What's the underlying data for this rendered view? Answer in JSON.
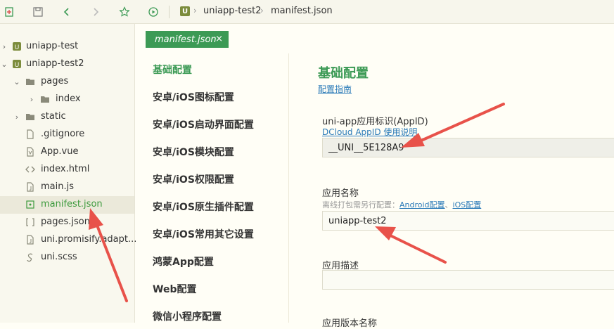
{
  "breadcrumb": {
    "logo": "U",
    "project": "uniapp-test2",
    "file": "manifest.json"
  },
  "tree": [
    {
      "label": "uniapp-test",
      "type": "project",
      "twisty": "collapsed"
    },
    {
      "label": "uniapp-test2",
      "type": "project",
      "twisty": "expanded"
    },
    {
      "label": "pages",
      "type": "folder-open",
      "twisty": "expanded"
    },
    {
      "label": "index",
      "type": "folder",
      "twisty": "collapsed"
    },
    {
      "label": "static",
      "type": "folder",
      "twisty": "collapsed"
    },
    {
      "label": ".gitignore",
      "type": "file"
    },
    {
      "label": "App.vue",
      "type": "vue-file"
    },
    {
      "label": "index.html",
      "type": "html-file"
    },
    {
      "label": "main.js",
      "type": "js-file"
    },
    {
      "label": "manifest.json",
      "type": "json-file",
      "selected": true
    },
    {
      "label": "pages.json",
      "type": "json-file"
    },
    {
      "label": "uni.promisify.adapt...",
      "type": "js-file"
    },
    {
      "label": "uni.scss",
      "type": "scss-file"
    }
  ],
  "tab": {
    "label": "manifest.json",
    "close": "×"
  },
  "nav": [
    {
      "label": "基础配置",
      "active": true
    },
    {
      "label": "安卓/iOS图标配置"
    },
    {
      "label": "安卓/iOS启动界面配置"
    },
    {
      "label": "安卓/iOS模块配置"
    },
    {
      "label": "安卓/iOS权限配置"
    },
    {
      "label": "安卓/iOS原生插件配置"
    },
    {
      "label": "安卓/iOS常用其它设置"
    },
    {
      "label": "鸿蒙App配置"
    },
    {
      "label": "Web配置"
    },
    {
      "label": "微信小程序配置"
    }
  ],
  "content": {
    "title": "基础配置",
    "guide_link": "配置指南",
    "appid": {
      "label": "uni-app应用标识(AppID)",
      "link": "DCloud AppID 使用说明",
      "value": "__UNI__5E128A9"
    },
    "appname": {
      "label": "应用名称",
      "hint_prefix": "离线打包需另行配置：",
      "hint_android": "Android配置",
      "hint_sep": "、",
      "hint_ios": "iOS配置",
      "value": "uniapp-test2"
    },
    "desc": {
      "label": "应用描述",
      "value": ""
    },
    "version": {
      "label": "应用版本名称"
    }
  },
  "colors": {
    "accent": "#3c9a55",
    "link": "#2a7ab8",
    "annotation": "#e8524a"
  }
}
